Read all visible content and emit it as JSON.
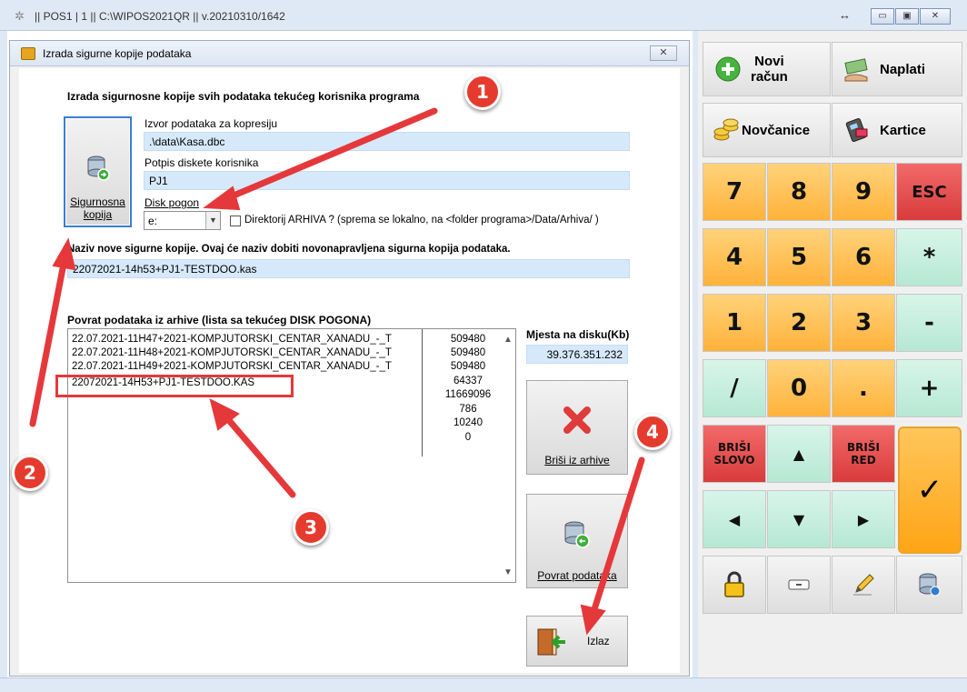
{
  "window": {
    "title": "|| POS1 | 1 || C:\\WIPOS2021QR || v.20210310/1642",
    "resize_glyph": "↔",
    "minimize": "▭",
    "maximize": "▣",
    "close": "✕"
  },
  "dialog": {
    "title": "Izrada sigurne kopije podataka",
    "close": "✕",
    "heading": "Izrada sigurnosne kopije svih podataka tekućeg korisnika programa",
    "backup_button": {
      "line1": "Sigurnosna",
      "line2": "kopija"
    },
    "source_label": "Izvor podataka za kopresiju",
    "source_value": ".\\data\\Kasa.dbc",
    "signature_label": "Potpis diskete korisnika",
    "signature_value": "PJ1",
    "drive_label": "Disk pogon",
    "drive_value": "e:",
    "archive_checkbox_label": "Direktorij ARHIVA ? (sprema se lokalno, na <folder programa>/Data/Arhiva/ )",
    "new_name_label": "Naziv nove sigurne kopije. Ovaj će naziv dobiti novonapravljena sigurna kopija podataka.",
    "new_name_value": "22072021-14h53+PJ1-TESTDOO.kas",
    "restore_label": "Povrat podataka iz arhive (lista sa tekućeg DISK POGONA)",
    "archive_files": [
      "22.07.2021-11H47+2021-KOMPJUTORSKI_CENTAR_XANADU_-_T",
      "22.07.2021-11H48+2021-KOMPJUTORSKI_CENTAR_XANADU_-_T",
      "22.07.2021-11H49+2021-KOMPJUTORSKI_CENTAR_XANADU_-_T",
      "22072021-14H53+PJ1-TESTDOO.KAS"
    ],
    "archive_sizes": [
      "509480",
      "509480",
      "509480",
      "64337",
      "11669096",
      "786",
      "10240",
      "0"
    ],
    "disk_space_label": "Mjesta na disku(Kb)",
    "disk_space_value": "39.376.351.232",
    "delete_button": "Briši iz arhive",
    "restore_button": "Povrat podataka",
    "exit_button": "Izlaz"
  },
  "keypad": {
    "new_invoice": {
      "line1": "Novi",
      "line2": "račun"
    },
    "pay": "Naplati",
    "cash": "Novčanice",
    "cards": "Kartice",
    "k7": "7",
    "k8": "8",
    "k9": "9",
    "esc": "ESC",
    "k4": "4",
    "k5": "5",
    "k6": "6",
    "multiply": "*",
    "k1": "1",
    "k2": "2",
    "k3": "3",
    "minus": "-",
    "divide": "/",
    "k0": "0",
    "dot": ".",
    "plus": "+",
    "delete_char": {
      "line1": "BRIŠI",
      "line2": "SLOVO"
    },
    "delete_row": {
      "line1": "BRIŠI",
      "line2": "RED"
    },
    "up": "▲",
    "down": "▼",
    "left": "◀",
    "right": "▶",
    "confirm": "✓"
  },
  "annotations": [
    "1",
    "2",
    "3",
    "4"
  ],
  "colors": {
    "field_bg": "#d6e9fb",
    "accent_red": "#e53b2e",
    "key_orange": "#ffb23a",
    "key_green": "#b6e8d4"
  }
}
